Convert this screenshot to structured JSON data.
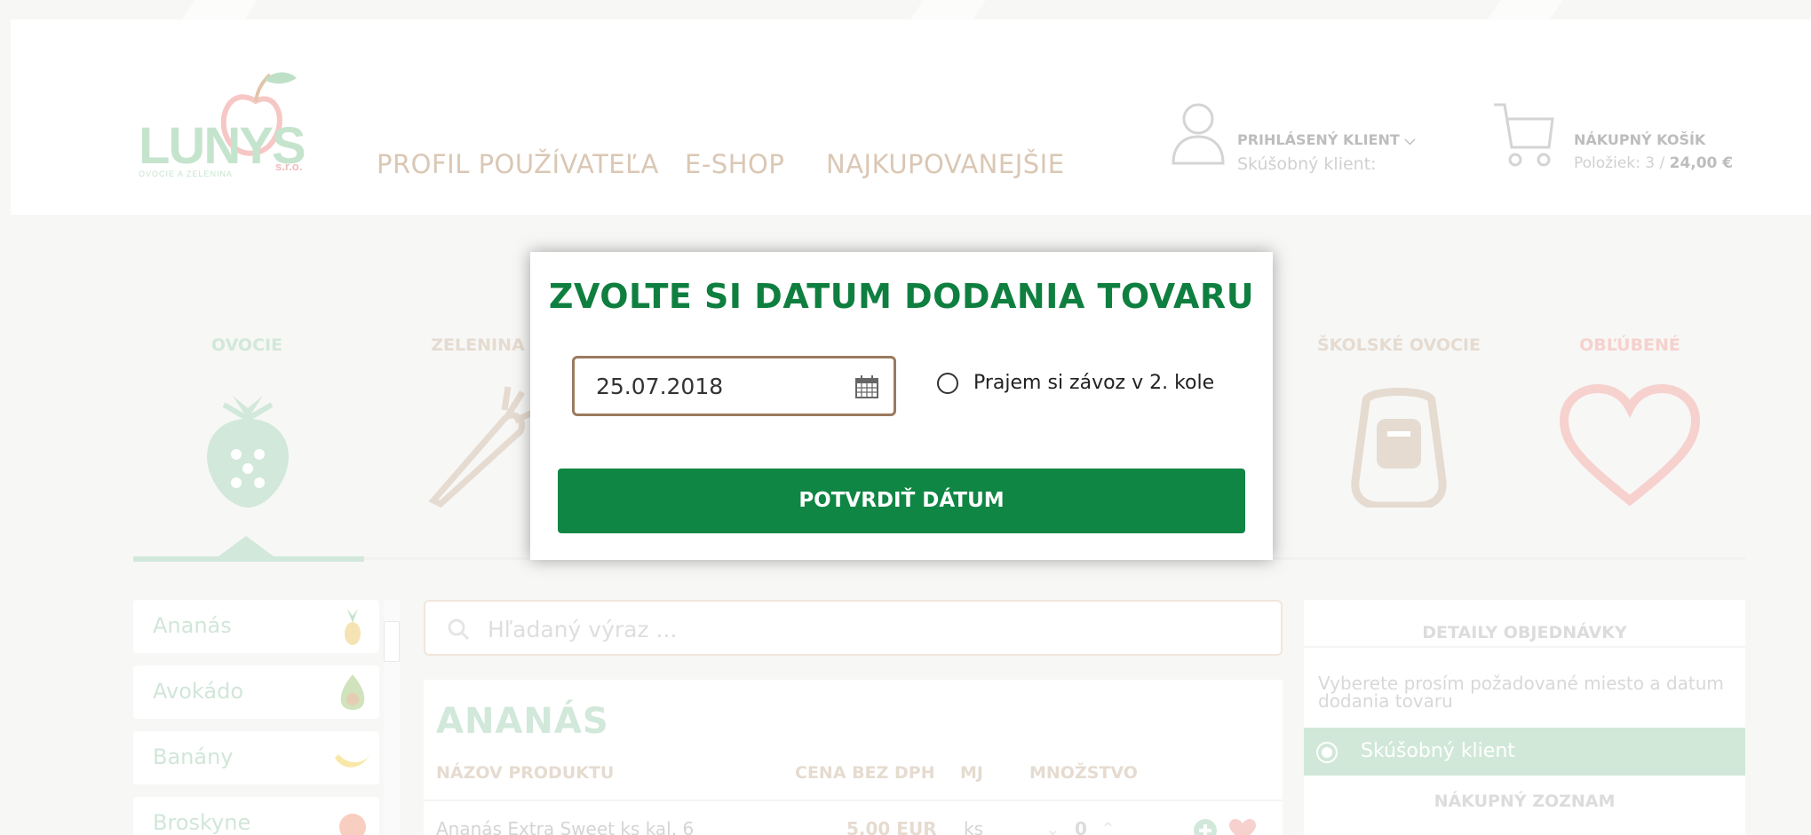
{
  "header": {
    "logo_text": "LUNYS",
    "logo_sro": "s.r.o.",
    "logo_tagline": "OVOCIE A ZELENINA",
    "nav": [
      "PROFIL POUŽÍVATEĽA",
      "E-SHOP",
      "NAJKUPOVANEJŠIE"
    ],
    "user": {
      "title": "PRIHLÁSENÝ KLIENT",
      "subtitle": "Skúšobný klient:"
    },
    "cart": {
      "title": "NÁKUPNÝ KOŠÍK",
      "items_label": "Položiek: 3 / ",
      "total": "24,00 €"
    }
  },
  "categories": [
    {
      "label": "OVOCIE",
      "color": "#b9dcc6",
      "icon": "strawberry-icon"
    },
    {
      "label": "ZELENINA",
      "color": "#d8c8b7",
      "icon": "carrot-icon"
    },
    {
      "label": "ŠKOLSKÉ OVOCIE",
      "color": "#d8c8b7",
      "icon": "backpack-icon"
    },
    {
      "label": "OBĽÚBENÉ",
      "color": "#f2b8b3",
      "icon": "heart-icon"
    }
  ],
  "sidebar": {
    "items": [
      {
        "label": "Ananás",
        "icon": "pineapple-icon"
      },
      {
        "label": "Avokádo",
        "icon": "avocado-icon"
      },
      {
        "label": "Banány",
        "icon": "banana-icon"
      },
      {
        "label": "Broskyne",
        "icon": "peach-icon"
      }
    ]
  },
  "search": {
    "placeholder": "Hľadaný výraz ..."
  },
  "product_table": {
    "title": "ANANÁS",
    "headers": {
      "name": "NÁZOV PRODUKTU",
      "price": "CENA BEZ DPH",
      "unit": "MJ",
      "qty": "MNOŽSTVO"
    },
    "rows": [
      {
        "name": "Ananás Extra Sweet ks kal. 6",
        "price": "5,00 EUR",
        "unit": "ks",
        "qty": "0"
      }
    ]
  },
  "order_panel": {
    "title": "DETAILY OBJEDNÁVKY",
    "text": "Vyberete prosím požadované miesto a datum dodania tovaru",
    "selected_client": "Skúšobný klient",
    "list_title": "NÁKUPNÝ ZOZNAM"
  },
  "modal": {
    "title": "ZVOLTE SI DATUM DODANIA TOVARU",
    "date_value": "25.07.2018",
    "second_round_label": "Prajem si závoz v 2. kole",
    "confirm_label": "POTVRDIŤ DÁTUM"
  },
  "colors": {
    "accent_green": "#0f8644",
    "title_green": "#0f7f40",
    "muted_green": "#b9dcc6",
    "tan": "#d8c8b7",
    "pink": "#f2b8b3"
  }
}
